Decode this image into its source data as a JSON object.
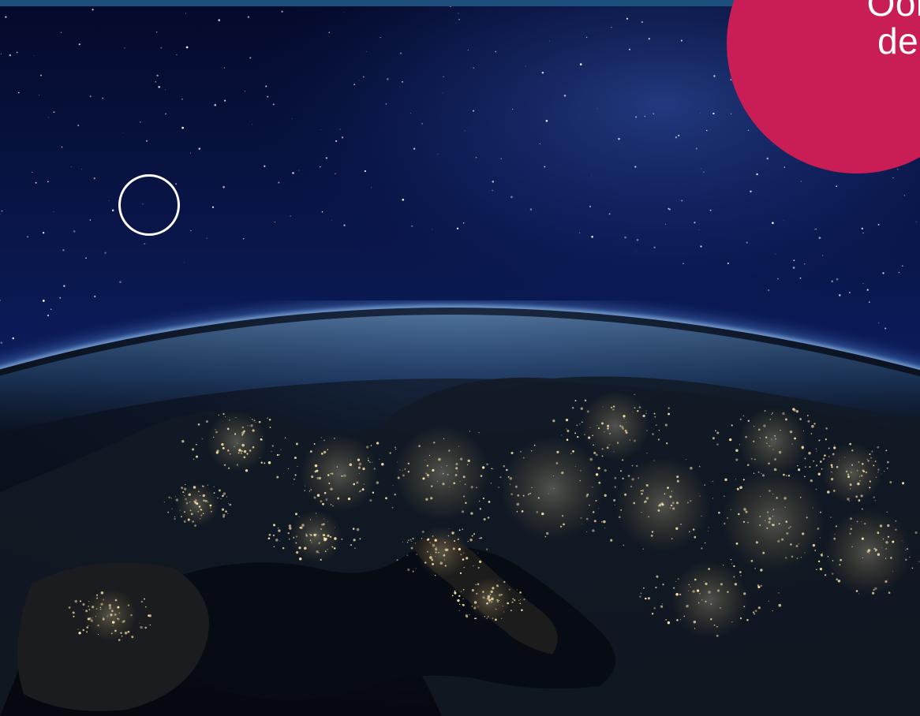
{
  "badge": {
    "line1": "Ook vo",
    "line2": "de AV",
    "color": "#c81d55"
  },
  "colors": {
    "top_bar": "#1d4f7c",
    "space": "#050b2e",
    "city_lights": "#ffe6a8",
    "atmosphere": "#4f9be8"
  },
  "photo": {
    "subject": "earth-at-night-europe-icon"
  }
}
